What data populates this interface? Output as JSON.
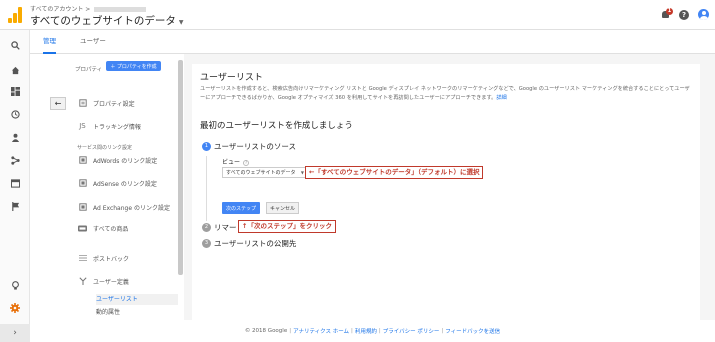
{
  "header": {
    "account_breadcrumb": "すべてのアカウント >",
    "view_title": "すべてのウェブサイトのデータ",
    "notification_count": "1"
  },
  "tabs": [
    "管理",
    "ユーザー"
  ],
  "admin_panel": {
    "property_label": "プロパティ",
    "create_property": "＋ プロパティを作成",
    "back_icon": "arrow-left-icon",
    "items": [
      {
        "label": "プロパティ設定",
        "icon": "property-settings-icon"
      },
      {
        "label": "トラッキング情報",
        "icon": "tracking-code-icon"
      }
    ],
    "section_label": "サービス間のリンク設定",
    "link_items": [
      {
        "label": "AdWords のリンク設定",
        "icon": "adwords-link-icon"
      },
      {
        "label": "AdSense のリンク設定",
        "icon": "adsense-link-icon"
      },
      {
        "label": "Ad Exchange のリンク設定",
        "icon": "adexchange-link-icon"
      },
      {
        "label": "すべての商品",
        "icon": "all-products-icon"
      }
    ],
    "postback": "ポストバック",
    "audience_definitions": "ユーザー定義",
    "sub_items": [
      "ユーザーリスト",
      "動的属性"
    ]
  },
  "main": {
    "title": "ユーザーリスト",
    "description": "ユーザーリストを作成すると、検索広告向けリマーケティング リストと Google ディスプレイ ネットワークのリマーケティングなどで、Google のユーザーリスト マーケティングを統合することにとってユーザーにアプローチできるばかりか、Google オプティマイズ 360 を利用してサイトを再訪問したユーザーにアプローチできます。",
    "description_link": "詳細",
    "subtitle": "最初のユーザーリストを作成しましょう",
    "steps": [
      {
        "num": "1",
        "title": "ユーザーリストのソース"
      },
      {
        "num": "2",
        "title": "リマー"
      },
      {
        "num": "3",
        "title": "ユーザーリストの公開先"
      }
    ],
    "view_label": "ビュー",
    "view_select_value": "すべてのウェブサイトのデータ",
    "next_step": "次のステップ",
    "cancel": "キャンセル"
  },
  "annotations": {
    "select_note": "←「すべてのウェブサイトのデータ」（デフォルト）に選択",
    "click_note": "↑「次のステップ」をクリック"
  },
  "footer": {
    "copyright": "© 2018 Google",
    "links": [
      "アナリティクス ホーム",
      "利用規約",
      "プライバシー ポリシー",
      "フィードバックを送信"
    ]
  },
  "colors": {
    "accent": "#4285f4",
    "logo": "#f9ab00",
    "annotation": "#c0392b"
  }
}
